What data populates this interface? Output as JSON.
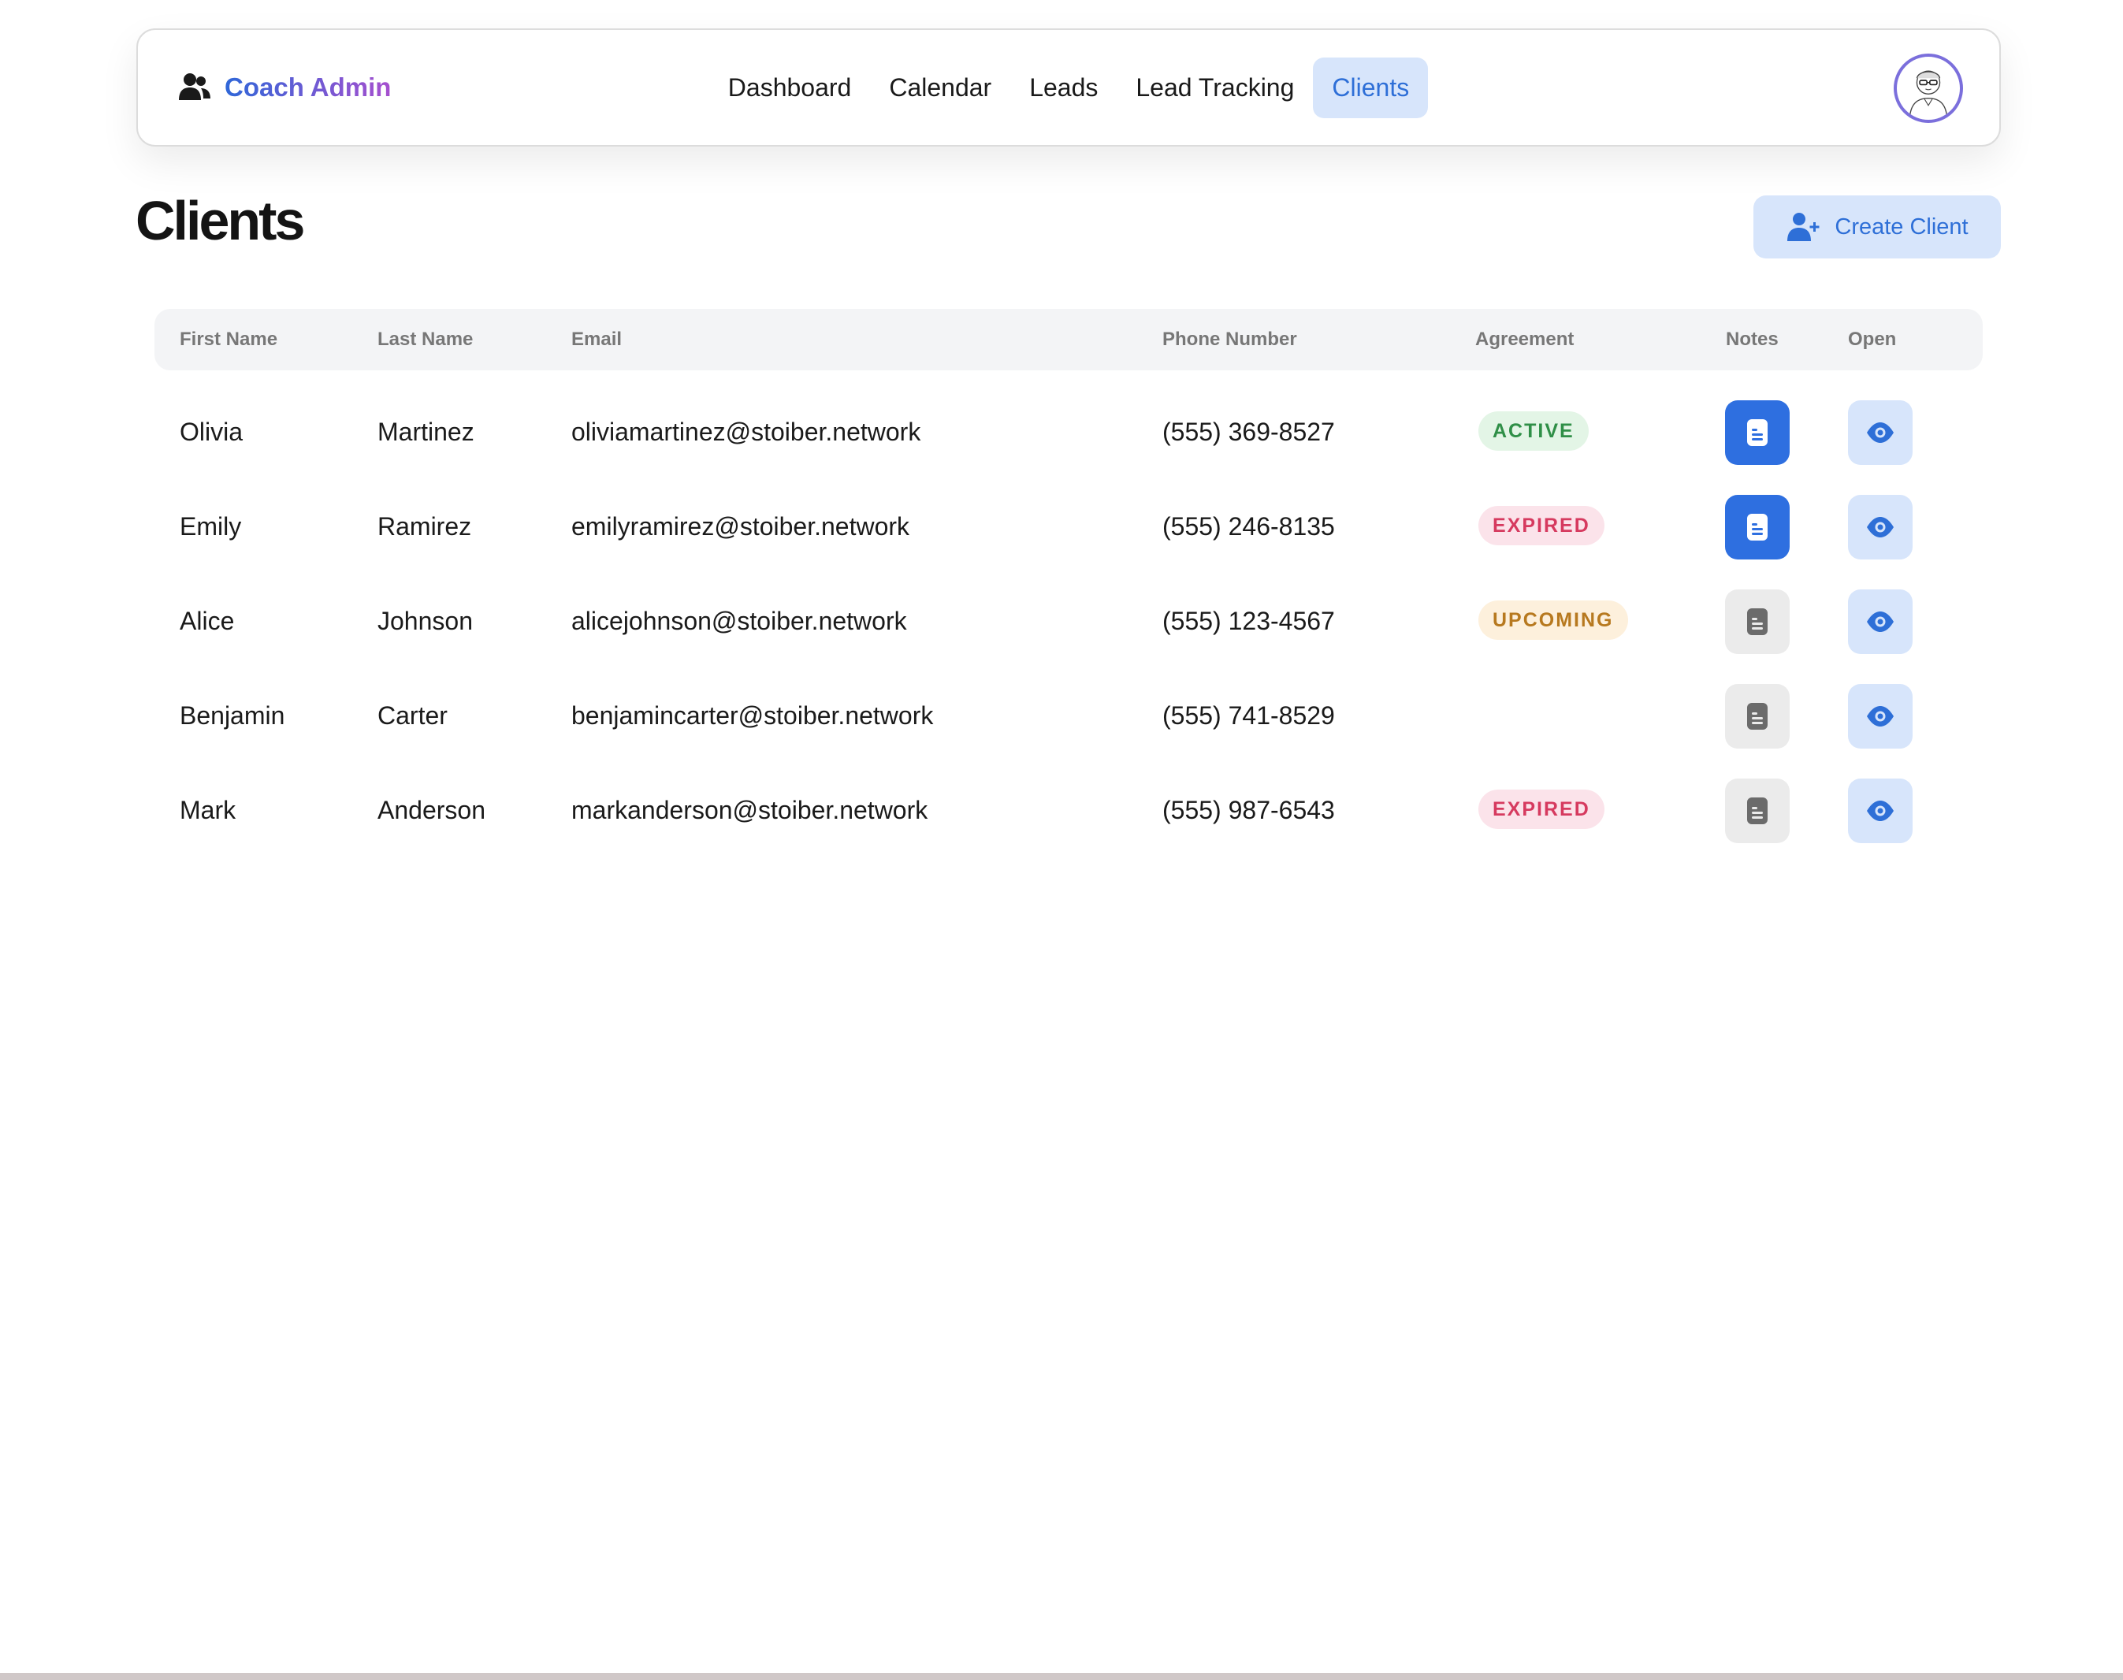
{
  "nav": {
    "brand": "Coach Admin",
    "links": [
      {
        "label": "Dashboard",
        "active": false
      },
      {
        "label": "Calendar",
        "active": false
      },
      {
        "label": "Leads",
        "active": false
      },
      {
        "label": "Lead Tracking",
        "active": false
      },
      {
        "label": "Clients",
        "active": true
      }
    ]
  },
  "page": {
    "title": "Clients",
    "create_label": "Create Client"
  },
  "table": {
    "headers": {
      "first_name": "First Name",
      "last_name": "Last Name",
      "email": "Email",
      "phone": "Phone Number",
      "agreement": "Agreement",
      "notes": "Notes",
      "open": "Open"
    },
    "rows": [
      {
        "first": "Olivia",
        "last": "Martinez",
        "email": "oliviamartinez@stoiber.network",
        "phone": "(555) 369-8527",
        "agreement": "ACTIVE",
        "agreement_status": "active",
        "has_notes": true
      },
      {
        "first": "Emily",
        "last": "Ramirez",
        "email": "emilyramirez@stoiber.network",
        "phone": "(555) 246-8135",
        "agreement": "EXPIRED",
        "agreement_status": "expired",
        "has_notes": true
      },
      {
        "first": "Alice",
        "last": "Johnson",
        "email": "alicejohnson@stoiber.network",
        "phone": "(555) 123-4567",
        "agreement": "UPCOMING",
        "agreement_status": "upcoming",
        "has_notes": false
      },
      {
        "first": "Benjamin",
        "last": "Carter",
        "email": "benjamincarter@stoiber.network",
        "phone": "(555) 741-8529",
        "agreement": "",
        "agreement_status": "none",
        "has_notes": false
      },
      {
        "first": "Mark",
        "last": "Anderson",
        "email": "markanderson@stoiber.network",
        "phone": "(555) 987-6543",
        "agreement": "EXPIRED",
        "agreement_status": "expired",
        "has_notes": false
      }
    ]
  },
  "icons": {
    "brand": "users-icon",
    "create": "user-plus-icon",
    "notes": "document-icon",
    "open": "eye-icon",
    "avatar": "avatar-illustration"
  },
  "colors": {
    "accent": "#2e6fd7",
    "accent_light": "#d7e5fb",
    "brand_gradient_start": "#2f67d8",
    "brand_gradient_end": "#a64fcf",
    "active": "#2f8f47",
    "expired": "#d63a5f",
    "upcoming": "#b7791f"
  }
}
